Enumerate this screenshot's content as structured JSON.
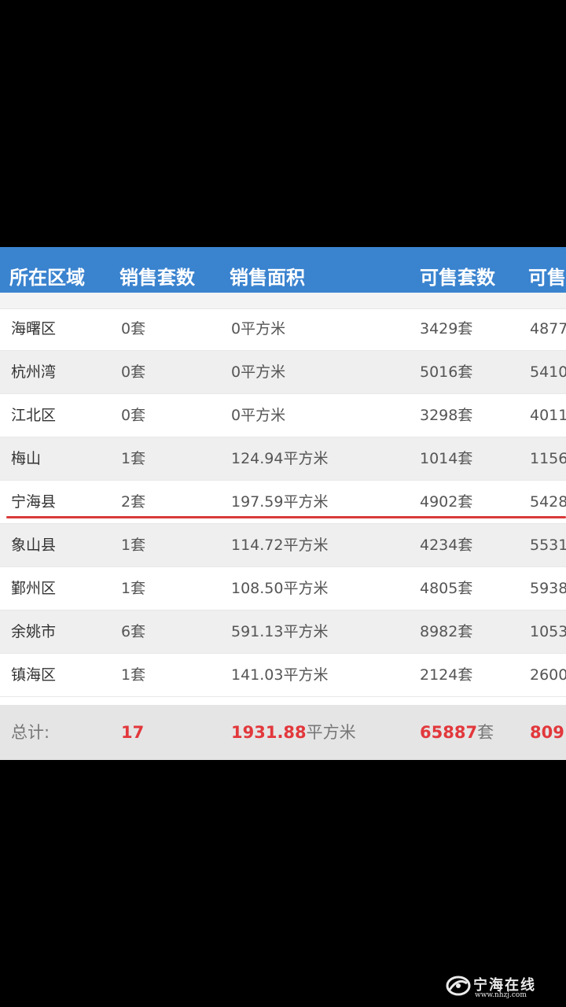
{
  "table": {
    "headers": [
      "所在区域",
      "销售套数",
      "销售面积",
      "可售套数",
      "可售"
    ],
    "rows": [
      {
        "region": "海曙区",
        "sold_units": "0套",
        "sold_area": "0平方米",
        "available_units": "3429套",
        "available_area": "4877"
      },
      {
        "region": "杭州湾",
        "sold_units": "0套",
        "sold_area": "0平方米",
        "available_units": "5016套",
        "available_area": "5410"
      },
      {
        "region": "江北区",
        "sold_units": "0套",
        "sold_area": "0平方米",
        "available_units": "3298套",
        "available_area": "4011"
      },
      {
        "region": "梅山",
        "sold_units": "1套",
        "sold_area": "124.94平方米",
        "available_units": "1014套",
        "available_area": "1156"
      },
      {
        "region": "宁海县",
        "sold_units": "2套",
        "sold_area": "197.59平方米",
        "available_units": "4902套",
        "available_area": "5428"
      },
      {
        "region": "象山县",
        "sold_units": "1套",
        "sold_area": "114.72平方米",
        "available_units": "4234套",
        "available_area": "5531"
      },
      {
        "region": "鄞州区",
        "sold_units": "1套",
        "sold_area": "108.50平方米",
        "available_units": "4805套",
        "available_area": "5938"
      },
      {
        "region": "余姚市",
        "sold_units": "6套",
        "sold_area": "591.13平方米",
        "available_units": "8982套",
        "available_area": "1053"
      },
      {
        "region": "镇海区",
        "sold_units": "1套",
        "sold_area": "141.03平方米",
        "available_units": "2124套",
        "available_area": "2600"
      }
    ],
    "highlighted_region": "宁海县",
    "total": {
      "label": "总计:",
      "sold_units": "17",
      "sold_area_value": "1931.88",
      "sold_area_unit": "平方米",
      "available_units_value": "65887",
      "available_units_unit": "套",
      "available_area_value": "809"
    }
  },
  "watermark": {
    "name": "宁海在线",
    "url": "www.nhzj.com",
    "icon": "swirl-logo-icon"
  },
  "colors": {
    "header_bg": "#3a83cf",
    "highlight_line": "#d93a3a",
    "total_red": "#e2383c"
  }
}
